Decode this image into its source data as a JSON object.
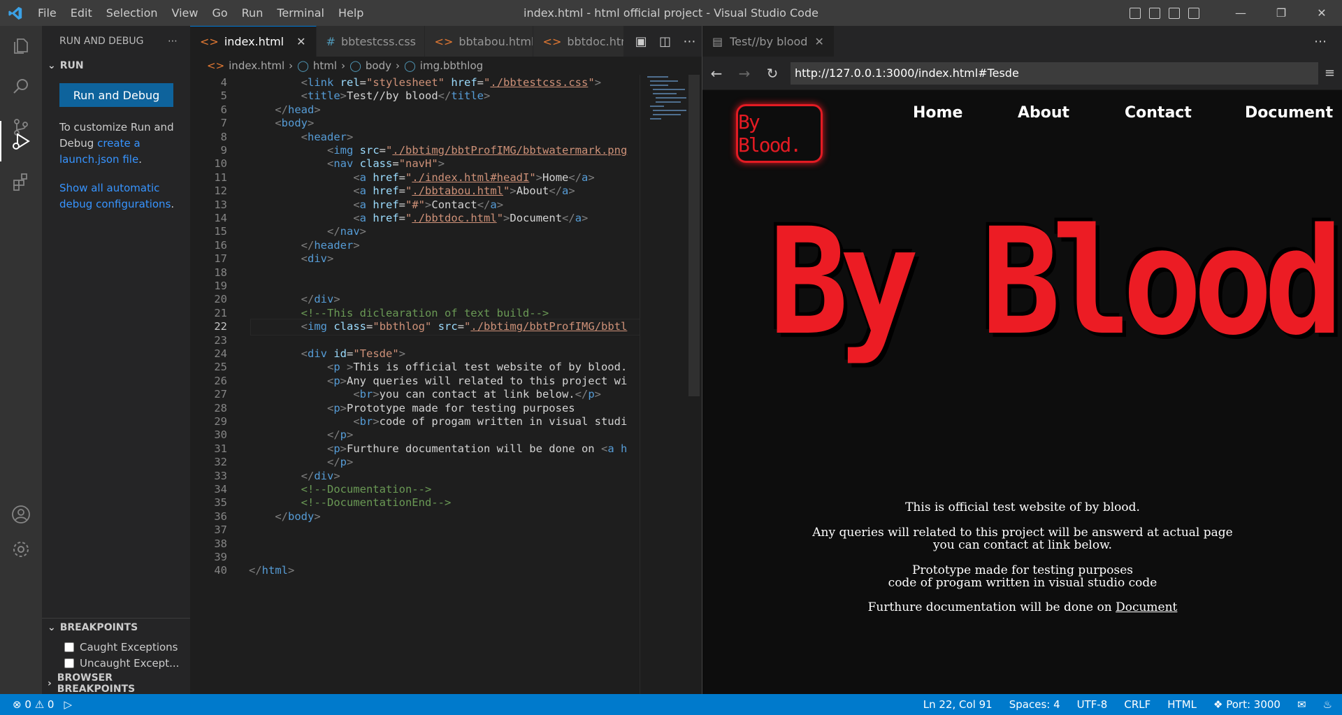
{
  "titlebar": {
    "menu": [
      "File",
      "Edit",
      "Selection",
      "View",
      "Go",
      "Run",
      "Terminal",
      "Help"
    ],
    "title": "index.html - html official project - Visual Studio Code"
  },
  "sidebar": {
    "title": "RUN AND DEBUG",
    "section": "RUN",
    "run_button": "Run and Debug",
    "text_prefix": "To customize Run and Debug ",
    "text_link": "create a launch.json file",
    "text_suffix": ".",
    "show_all_link": "Show all automatic debug configurations",
    "breakpoints_header": "BREAKPOINTS",
    "breakpoints": [
      "Caught Exceptions",
      "Uncaught Except..."
    ],
    "browser_breakpoints_header": "BROWSER BREAKPOINTS"
  },
  "editor": {
    "tabs": [
      "index.html",
      "bbtestcss.css",
      "bbtabou.html",
      "bbtdoc.html"
    ],
    "breadcrumb": [
      "index.html",
      "html",
      "body",
      "img.bbthlog"
    ],
    "lines": [
      {
        "n": "4",
        "html": "        <span class='br'>&lt;</span><span class='tg'>link</span> <span class='at'>rel</span><span class='tx'>=</span><span class='st'>\"stylesheet\"</span> <span class='at'>href</span><span class='tx'>=</span><span class='st'>\"<span class='ul'>./bbtestcss.css</span>\"</span><span class='br'>&gt;</span>"
      },
      {
        "n": "5",
        "html": "        <span class='br'>&lt;</span><span class='tg'>title</span><span class='br'>&gt;</span><span class='tx'>Test//by blood</span><span class='br'>&lt;/</span><span class='tg'>title</span><span class='br'>&gt;</span>"
      },
      {
        "n": "6",
        "html": "    <span class='br'>&lt;/</span><span class='tg'>head</span><span class='br'>&gt;</span>"
      },
      {
        "n": "7",
        "html": "    <span class='br'>&lt;</span><span class='tg'>body</span><span class='br'>&gt;</span>"
      },
      {
        "n": "8",
        "html": "        <span class='br'>&lt;</span><span class='tg'>header</span><span class='br'>&gt;</span>"
      },
      {
        "n": "9",
        "html": "            <span class='br'>&lt;</span><span class='tg'>img</span> <span class='at'>src</span><span class='tx'>=</span><span class='st'>\"<span class='ul'>./bbtimg/bbtProfIMG/bbtwatermark.png</span></span>"
      },
      {
        "n": "10",
        "html": "            <span class='br'>&lt;</span><span class='tg'>nav</span> <span class='at'>class</span><span class='tx'>=</span><span class='st'>\"navH\"</span><span class='br'>&gt;</span>"
      },
      {
        "n": "11",
        "html": "                <span class='br'>&lt;</span><span class='tg'>a</span> <span class='at'>href</span><span class='tx'>=</span><span class='st'>\"<span class='ul'>./index.html#headI</span>\"</span><span class='br'>&gt;</span><span class='tx'>Home</span><span class='br'>&lt;/</span><span class='tg'>a</span><span class='br'>&gt;</span>"
      },
      {
        "n": "12",
        "html": "                <span class='br'>&lt;</span><span class='tg'>a</span> <span class='at'>href</span><span class='tx'>=</span><span class='st'>\"<span class='ul'>./bbtabou.html</span>\"</span><span class='br'>&gt;</span><span class='tx'>About</span><span class='br'>&lt;/</span><span class='tg'>a</span><span class='br'>&gt;</span>"
      },
      {
        "n": "13",
        "html": "                <span class='br'>&lt;</span><span class='tg'>a</span> <span class='at'>href</span><span class='tx'>=</span><span class='st'>\"#\"</span><span class='br'>&gt;</span><span class='tx'>Contact</span><span class='br'>&lt;/</span><span class='tg'>a</span><span class='br'>&gt;</span>"
      },
      {
        "n": "14",
        "html": "                <span class='br'>&lt;</span><span class='tg'>a</span> <span class='at'>href</span><span class='tx'>=</span><span class='st'>\"<span class='ul'>./bbtdoc.html</span>\"</span><span class='br'>&gt;</span><span class='tx'>Document</span><span class='br'>&lt;/</span><span class='tg'>a</span><span class='br'>&gt;</span>"
      },
      {
        "n": "15",
        "html": "            <span class='br'>&lt;/</span><span class='tg'>nav</span><span class='br'>&gt;</span>"
      },
      {
        "n": "16",
        "html": "        <span class='br'>&lt;/</span><span class='tg'>header</span><span class='br'>&gt;</span>"
      },
      {
        "n": "17",
        "html": "        <span class='br'>&lt;</span><span class='tg'>div</span><span class='br'>&gt;</span>"
      },
      {
        "n": "18",
        "html": ""
      },
      {
        "n": "19",
        "html": ""
      },
      {
        "n": "20",
        "html": "        <span class='br'>&lt;/</span><span class='tg'>div</span><span class='br'>&gt;</span>"
      },
      {
        "n": "21",
        "html": "        <span class='cm'>&lt;!--This diclearation of text build--&gt;</span>"
      },
      {
        "n": "22",
        "html": "        <span class='br'>&lt;</span><span class='tg'>img</span> <span class='at'>class</span><span class='tx'>=</span><span class='st'>\"bbthlog\"</span> <span class='at'>src</span><span class='tx'>=</span><span class='st'>\"<span class='ul'>./bbtimg/bbtProfIMG/bbtl</span></span>",
        "current": true
      },
      {
        "n": "23",
        "html": ""
      },
      {
        "n": "24",
        "html": "        <span class='br'>&lt;</span><span class='tg'>div</span> <span class='at'>id</span><span class='tx'>=</span><span class='st'>\"Tesde\"</span><span class='br'>&gt;</span>"
      },
      {
        "n": "25",
        "html": "            <span class='br'>&lt;</span><span class='tg'>p</span> <span class='br'>&gt;</span><span class='tx'>This is official test website of by blood.</span>"
      },
      {
        "n": "26",
        "html": "            <span class='br'>&lt;</span><span class='tg'>p</span><span class='br'>&gt;</span><span class='tx'>Any queries will related to this project wi</span>"
      },
      {
        "n": "27",
        "html": "                <span class='br'>&lt;</span><span class='tg'>br</span><span class='br'>&gt;</span><span class='tx'>you can contact at link below.</span><span class='br'>&lt;/</span><span class='tg'>p</span><span class='br'>&gt;</span>"
      },
      {
        "n": "28",
        "html": "            <span class='br'>&lt;</span><span class='tg'>p</span><span class='br'>&gt;</span><span class='tx'>Prototype made for testing purposes</span>"
      },
      {
        "n": "29",
        "html": "                <span class='br'>&lt;</span><span class='tg'>br</span><span class='br'>&gt;</span><span class='tx'>code of progam written in visual studi</span>"
      },
      {
        "n": "30",
        "html": "            <span class='br'>&lt;/</span><span class='tg'>p</span><span class='br'>&gt;</span>"
      },
      {
        "n": "31",
        "html": "            <span class='br'>&lt;</span><span class='tg'>p</span><span class='br'>&gt;</span><span class='tx'>Furthure documentation will be done on </span><span class='br'>&lt;</span><span class='tg'>a h</span>"
      },
      {
        "n": "32",
        "html": "            <span class='br'>&lt;/</span><span class='tg'>p</span><span class='br'>&gt;</span>"
      },
      {
        "n": "33",
        "html": "        <span class='br'>&lt;/</span><span class='tg'>div</span><span class='br'>&gt;</span>"
      },
      {
        "n": "34",
        "html": "        <span class='cm'>&lt;!--Documentation--&gt;</span>"
      },
      {
        "n": "35",
        "html": "        <span class='cm'>&lt;!--DocumentationEnd--&gt;</span>"
      },
      {
        "n": "36",
        "html": "    <span class='br'>&lt;/</span><span class='tg'>body</span><span class='br'>&gt;</span>"
      },
      {
        "n": "37",
        "html": ""
      },
      {
        "n": "38",
        "html": ""
      },
      {
        "n": "39",
        "html": ""
      },
      {
        "n": "40",
        "html": "<span class='br'>&lt;/</span><span class='tg'>html</span><span class='br'>&gt;</span>"
      }
    ]
  },
  "browser": {
    "tab_title": "Test//by blood",
    "url": "http://127.0.0.1:3000/index.html#Tesde",
    "page": {
      "logo_text": "By Blood.",
      "nav": [
        "Home",
        "About",
        "Contact",
        "Document"
      ],
      "hero_text": "By Blood.",
      "p1": "This is official test website of by blood.",
      "p2a": "Any queries will related to this project will be answerd at actual page",
      "p2b": "you can contact at link below.",
      "p3a": "Prototype made for testing purposes",
      "p3b": "code of progam written in visual studio code",
      "p4_prefix": "Furthure documentation will be done on ",
      "p4_link": "Document"
    }
  },
  "status": {
    "errors": "0",
    "warnings": "0",
    "position": "Ln 22, Col 91",
    "spaces": "Spaces: 4",
    "encoding": "UTF-8",
    "eol": "CRLF",
    "language": "HTML",
    "port": "Port: 3000"
  },
  "colors": {
    "accent": "#007acc",
    "brand_red": "#ec1c24"
  }
}
